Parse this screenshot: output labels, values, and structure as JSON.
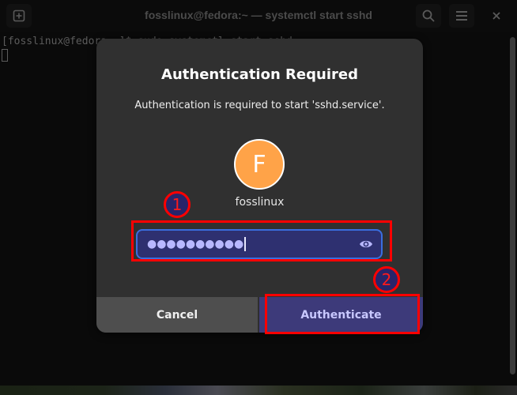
{
  "window": {
    "title": "fosslinux@fedora:~ — systemctl start sshd",
    "buttons": {
      "new_tab_icon": "new-tab-icon",
      "search_icon": "search-icon",
      "menu_icon": "hamburger-menu-icon",
      "close_icon": "close-icon"
    }
  },
  "terminal": {
    "prompt_line": "[fosslinux@fedora ~]$ sudo systemctl start sshd"
  },
  "dialog": {
    "title": "Authentication Required",
    "description": "Authentication is required to start 'sshd.service'.",
    "avatar_initial": "F",
    "avatar_color": "#ffa348",
    "username": "fosslinux",
    "password_value": "●●●●●●●●●●",
    "reveal_icon": "eye-icon",
    "cancel_label": "Cancel",
    "authenticate_label": "Authenticate",
    "accent_color": "#3d3a7a"
  },
  "annotations": [
    {
      "number": "1",
      "target": "password-field"
    },
    {
      "number": "2",
      "target": "authenticate-button"
    }
  ]
}
